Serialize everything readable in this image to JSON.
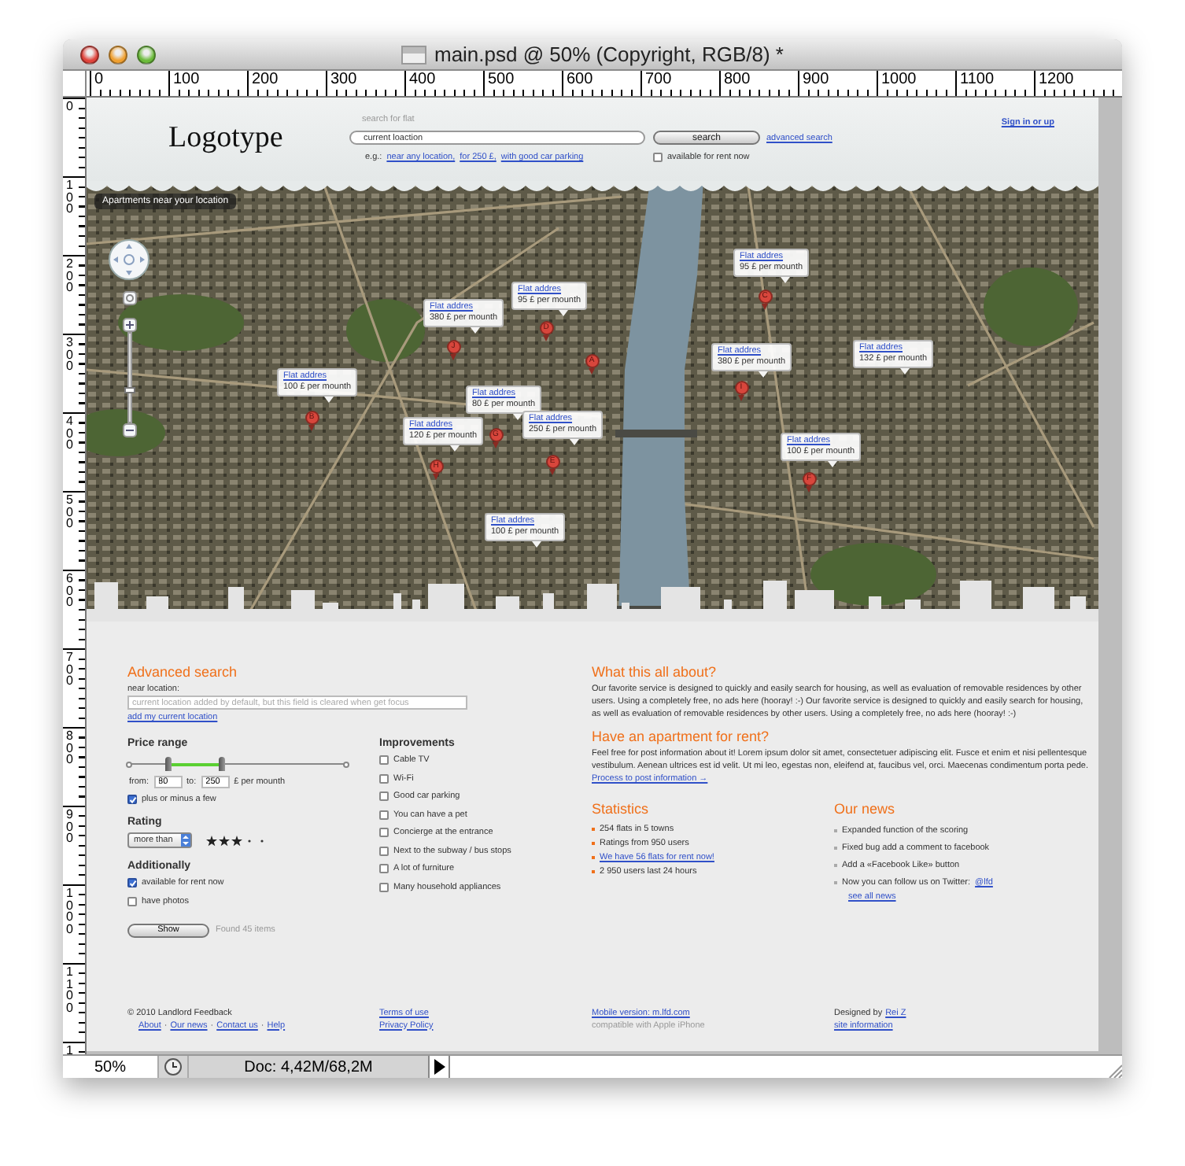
{
  "window": {
    "title": "main.psd @ 50% (Copyright, RGB/8) *"
  },
  "rulers": {
    "horizontal": [
      "0",
      "100",
      "200",
      "300",
      "400",
      "500",
      "600",
      "700",
      "800",
      "900",
      "1000",
      "1100",
      "1200"
    ],
    "vertical": [
      "0",
      "100",
      "200",
      "300",
      "400",
      "500",
      "600",
      "700",
      "800",
      "900",
      "1000",
      "1100",
      "1"
    ]
  },
  "header": {
    "logo": "Logotype",
    "search": {
      "label": "search for flat",
      "value": "current loaction",
      "button": "search",
      "advanced_link": "advanced search",
      "example_prefix": "e.g.:",
      "examples": [
        "near any location,",
        "for 250 £,",
        "with good car parking"
      ],
      "rent_now": {
        "label": "available for rent now",
        "checked": false
      }
    },
    "sign_in": "Sign in or up"
  },
  "map": {
    "caption": "Apartments near your location",
    "zoom": {
      "level": 0.35
    },
    "callouts": [
      {
        "link": "Flat addres",
        "price": "95 £ per mounth"
      },
      {
        "link": "Flat addres",
        "price": "95 £ per mounth"
      },
      {
        "link": "Flat addres",
        "price": "380 £ per mounth"
      },
      {
        "link": "Flat addres",
        "price": "380 £ per mounth"
      },
      {
        "link": "Flat addres",
        "price": "132 £ per mounth"
      },
      {
        "link": "Flat addres",
        "price": "100 £ per mounth"
      },
      {
        "link": "Flat addres",
        "price": "80 £ per mounth"
      },
      {
        "link": "Flat addres",
        "price": "250 £ per mounth"
      },
      {
        "link": "Flat addres",
        "price": "120 £ per mounth"
      },
      {
        "link": "Flat addres",
        "price": "100 £ per mounth"
      },
      {
        "link": "Flat addres",
        "price": "100 £ per mounth"
      }
    ],
    "pins": [
      "C",
      "D",
      "J",
      "A",
      "I",
      "B",
      "G",
      "E",
      "H",
      "F"
    ]
  },
  "advanced_search": {
    "title": "Advanced search",
    "location_label": "near location:",
    "location_placeholder": "current location added by default, but this field is cleared when get focus",
    "add_location_link": "add my current location",
    "price": {
      "title": "Price range",
      "handles": [
        {
          "level": 0.18
        },
        {
          "level": 0.43
        }
      ],
      "from_label": "from:",
      "from_value": "80",
      "to_label": "to:",
      "to_value": "250",
      "unit": "£ per mounth",
      "plus_minus": {
        "label": "plus or minus a few",
        "checked": true
      }
    },
    "rating": {
      "title": "Rating",
      "select": "more than",
      "stars": 3
    },
    "additionally": {
      "title": "Additionally",
      "options": [
        {
          "label": "available for rent now",
          "checked": true
        },
        {
          "label": "have photos",
          "checked": false
        }
      ]
    },
    "show_button": "Show",
    "found": "Found 45 items",
    "improvements": {
      "title": "Improvements",
      "options": [
        {
          "label": "Cable TV",
          "checked": false
        },
        {
          "label": "Wi-Fi",
          "checked": false
        },
        {
          "label": "Good car parking",
          "checked": false
        },
        {
          "label": "You can have a pet",
          "checked": false
        },
        {
          "label": "Concierge at the entrance",
          "checked": false
        },
        {
          "label": "Next to the subway / bus stops",
          "checked": false
        },
        {
          "label": "A lot of furniture",
          "checked": false
        },
        {
          "label": "Many household appliances",
          "checked": false
        }
      ]
    }
  },
  "about": {
    "title": "What this all about?",
    "text": "Our favorite service is designed to quickly and easily search for housing, as well as evaluation of removable residences by other users. Using a completely free, no ads here (hooray! :-) Our favorite service is designed to quickly and easily search for housing, as well as evaluation of removable residences by other users. Using a completely free, no ads here (hooray! :-)"
  },
  "rent": {
    "title": "Have an apartment for rent?",
    "text": "Feel free for post information about it! Lorem ipsum dolor sit amet, consectetuer adipiscing elit. Fusce et enim et nisi pellentesque vestibulum. Aenean ultrices est id velit. Ut mi leo, egestas non, eleifend at, faucibus vel, orci. Maecenas condimentum porta pede.",
    "link": "Process to post information →"
  },
  "statistics": {
    "title": "Statistics",
    "items": [
      {
        "kind": "text",
        "text": "254 flats in 5 towns"
      },
      {
        "kind": "text",
        "text": "Ratings from 950 users"
      },
      {
        "kind": "link",
        "text": "We have 56 flats for rent now!"
      },
      {
        "kind": "text",
        "text": "2 950 users last 24 hours"
      }
    ]
  },
  "news": {
    "title": "Our news",
    "items": [
      {
        "text": "Expanded function of the scoring"
      },
      {
        "text": "Fixed bug add a comment to facebook"
      },
      {
        "text": "Add a «Facebook Like» button"
      },
      {
        "text": "Now you can follow us on Twitter:",
        "link": "@lfd"
      }
    ],
    "more": "see all news"
  },
  "footer": {
    "copyright": "© 2010 Landlord Feedback",
    "links": [
      "About",
      "Our news",
      "Contact us",
      "Help"
    ],
    "separator": "·",
    "terms": "Terms of use",
    "privacy": "Privacy Policy",
    "mobile": "Mobile version: m.lfd.com",
    "mobile_note": "compatible with Apple iPhone",
    "designed_by": "Designed by",
    "designer": "Rei Z",
    "site_info": "site information"
  },
  "status_bar": {
    "zoom": "50%",
    "doc": "Doc: 4,42M/68,2M"
  }
}
